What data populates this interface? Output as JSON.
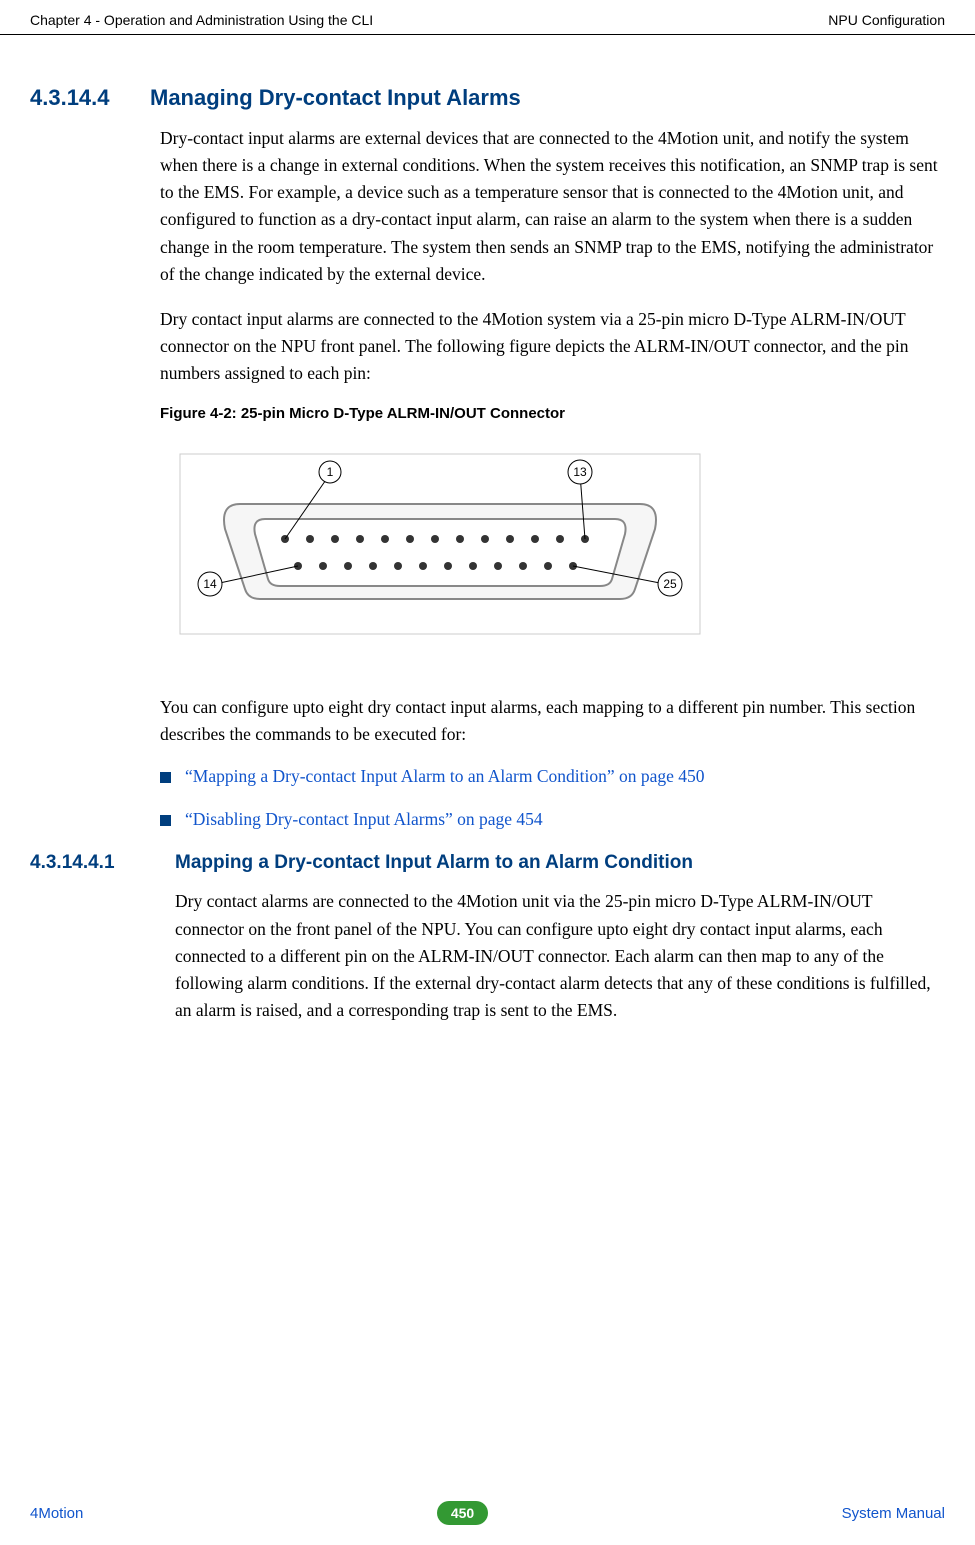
{
  "header": {
    "left": "Chapter 4 - Operation and Administration Using the CLI",
    "right": "NPU Configuration"
  },
  "section1": {
    "number": "4.3.14.4",
    "title": "Managing Dry-contact Input Alarms",
    "para1": "Dry-contact input alarms are external devices that are connected to the 4Motion unit, and notify the system when there is a change in external conditions. When the system receives this notification, an SNMP trap is sent to the EMS. For example, a device such as a temperature sensor that is connected to the 4Motion unit, and configured to function as a dry-contact input alarm, can raise an alarm to the system when there is a sudden change in the room temperature. The system then sends an SNMP trap to the EMS, notifying the administrator of the change indicated by the external device.",
    "para2": "Dry contact input alarms are connected to the 4Motion system via a 25-pin micro D-Type ALRM-IN/OUT connector on the NPU front panel. The following figure depicts the ALRM-IN/OUT connector, and the pin numbers assigned to each pin:",
    "figure_caption": "Figure 4-2: 25-pin Micro D-Type ALRM-IN/OUT Connector",
    "para3": "You can configure upto eight dry contact input alarms, each mapping to a different pin number. This section describes the commands to be executed for:",
    "links": [
      "“Mapping a Dry-contact Input Alarm to an Alarm Condition” on page 450",
      "“Disabling Dry-contact Input Alarms” on page 454"
    ]
  },
  "section2": {
    "number": "4.3.14.4.1",
    "title": "Mapping a Dry-contact Input Alarm to an Alarm Condition",
    "para1": "Dry contact alarms are connected to the 4Motion unit via the 25-pin micro D-Type ALRM-IN/OUT connector on the front panel of the NPU. You can configure upto eight dry contact input alarms, each connected to a different pin on the ALRM-IN/OUT connector. Each alarm can then map to any of the following alarm conditions. If the external dry-contact alarm detects that any of these conditions is fulfilled, an alarm is raised, and a corresponding trap is sent to the EMS."
  },
  "connector_pins": {
    "p1": "1",
    "p13": "13",
    "p14": "14",
    "p25": "25"
  },
  "footer": {
    "left": "4Motion",
    "page": "450",
    "right": "System Manual"
  }
}
